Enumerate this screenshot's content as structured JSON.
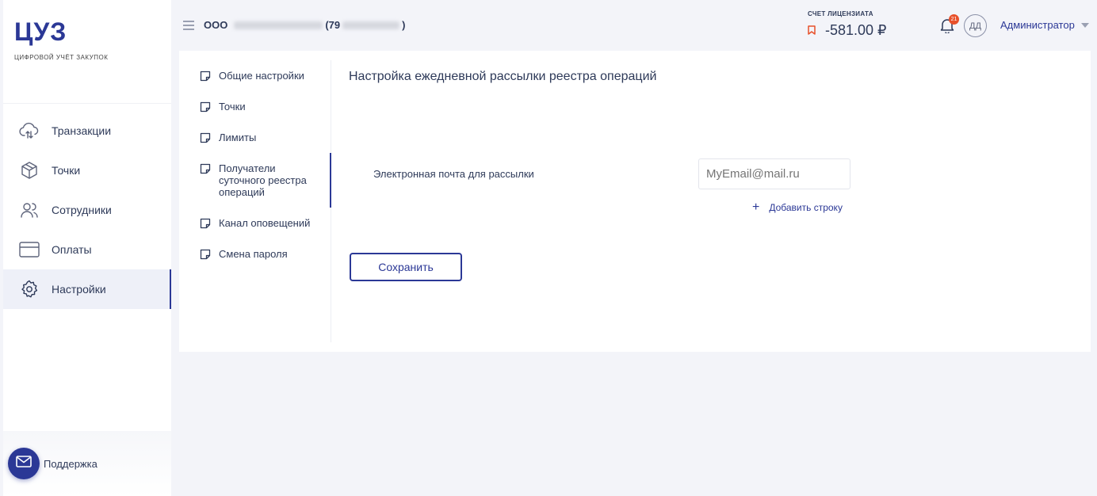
{
  "brand": {
    "logo": "ЦУЗ",
    "tagline": "ЦИФРОВОЙ УЧЁТ ЗАКУПОК"
  },
  "sidebar": {
    "items": [
      {
        "label": "Транзакции",
        "icon": "cloud-sync-icon"
      },
      {
        "label": "Точки",
        "icon": "box-icon"
      },
      {
        "label": "Сотрудники",
        "icon": "users-icon"
      },
      {
        "label": "Оплаты",
        "icon": "card-icon"
      },
      {
        "label": "Настройки",
        "icon": "gear-icon",
        "active": true
      }
    ],
    "support_label": "Поддержка"
  },
  "header": {
    "org_prefix": "ООО",
    "org_suffix": "(79",
    "org_close": ")",
    "account_label": "СЧЕТ ЛИЦЕНЗИАТА",
    "account_value": "-581.00 ₽",
    "notifications_count": "21",
    "avatar_initials": "ДД",
    "user_role": "Администратор"
  },
  "subnav": {
    "items": [
      {
        "label": "Общие настройки"
      },
      {
        "label": "Точки"
      },
      {
        "label": "Лимиты"
      },
      {
        "label": "Получатели суточного реестра операций",
        "active": true
      },
      {
        "label": "Канал оповещений"
      },
      {
        "label": "Смена пароля"
      }
    ]
  },
  "content": {
    "title": "Настройка ежедневной рассылки реестра операций",
    "email_label": "Электронная почта для рассылки",
    "email_placeholder": "MyEmail@mail.ru",
    "add_row": "Добавить строку",
    "save": "Сохранить"
  },
  "colors": {
    "accent": "#2b3896",
    "negative": "#e8502a",
    "background": "#f3f4f9"
  }
}
